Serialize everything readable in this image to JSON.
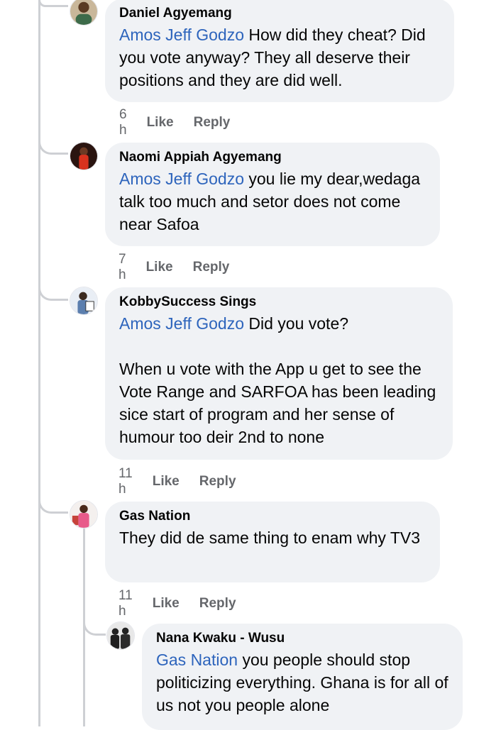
{
  "comments": [
    {
      "author": "Daniel Agyemang",
      "mention": "Amos Jeff Godzo",
      "text": " How did they cheat? Did you vote anyway? They all deserve their positions and they are did well.",
      "time": "6 h",
      "like": "Like",
      "reply": "Reply"
    },
    {
      "author": "Naomi Appiah Agyemang",
      "mention": "Amos Jeff Godzo",
      "text": " you lie my dear,wedaga talk too much and setor does not come near Safoa",
      "time": "7 h",
      "like": "Like",
      "reply": "Reply"
    },
    {
      "author": "KobbySuccess Sings",
      "mention": "Amos Jeff Godzo",
      "text": " Did you vote?\n\nWhen u vote with the App u get to see the Vote Range and SARFOA has been leading sice start of program and her sense of humour too deir 2nd to none",
      "time": "11 h",
      "like": "Like",
      "reply": "Reply"
    },
    {
      "author": "Gas Nation",
      "mention": "",
      "text": "They did de same thing to enam why TV3",
      "time": "11 h",
      "like": "Like",
      "reply": "Reply"
    },
    {
      "author": "Nana Kwaku - Wusu",
      "mention": "Gas Nation",
      "text": " you people should stop politicizing everything. Ghana is for all of us not you people alone",
      "time": "",
      "like": "",
      "reply": ""
    }
  ],
  "colors": {
    "bubble": "#f0f2f5",
    "mention": "#2d64bc",
    "meta": "#65676b",
    "thread": "#ced0d4"
  },
  "icons": [
    "avatar-daniel",
    "avatar-naomi",
    "avatar-kobby",
    "avatar-gas-nation",
    "avatar-nana"
  ]
}
